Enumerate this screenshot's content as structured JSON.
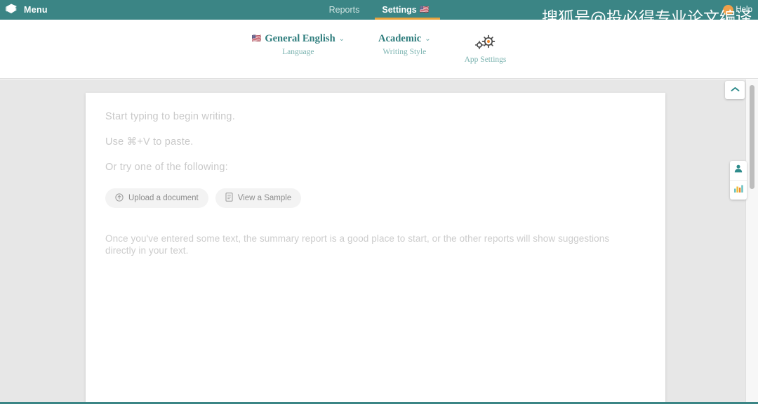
{
  "topbar": {
    "logo_icon": "stacked-books-logo-icon",
    "menu_label": "Menu",
    "nav": [
      {
        "label": "Reports",
        "active": false,
        "flag": ""
      },
      {
        "label": "Settings",
        "active": true,
        "flag": "🇺🇸"
      }
    ],
    "help_label": "Help",
    "background_color": "#3b8585",
    "active_underline_color": "#e8a33d",
    "help_badge_color": "#f0a04a"
  },
  "watermark": {
    "text": "搜狐号@投必得专业论文编译"
  },
  "settings": {
    "language": {
      "value": "General English",
      "label": "Language",
      "flag": "🇺🇸",
      "caret": "⌄"
    },
    "writing_style": {
      "value": "Academic",
      "label": "Writing Style",
      "caret": "⌄"
    },
    "app_settings": {
      "label": "App Settings",
      "icon": "double-gear-icon"
    },
    "accent_color": "#2e7d7d",
    "label_color": "#7bb3b0"
  },
  "editor": {
    "lines": [
      "Start typing to begin writing.",
      "Use ⌘+V to paste.",
      "Or try one of the following:"
    ],
    "buttons": [
      {
        "label": "Upload a document",
        "icon": "upload-circle-icon"
      },
      {
        "label": "View a Sample",
        "icon": "document-icon"
      }
    ],
    "summary_hint": "Once you've entered some text, the summary report is a good place to start, or the other reports will show suggestions directly in your text."
  },
  "right_panel": {
    "collapse_icon": "chevron-up-icon",
    "tools": [
      {
        "icon": "person-icon",
        "name": "audience-tool"
      },
      {
        "icon": "bar-chart-icon",
        "name": "statistics-tool"
      }
    ]
  }
}
